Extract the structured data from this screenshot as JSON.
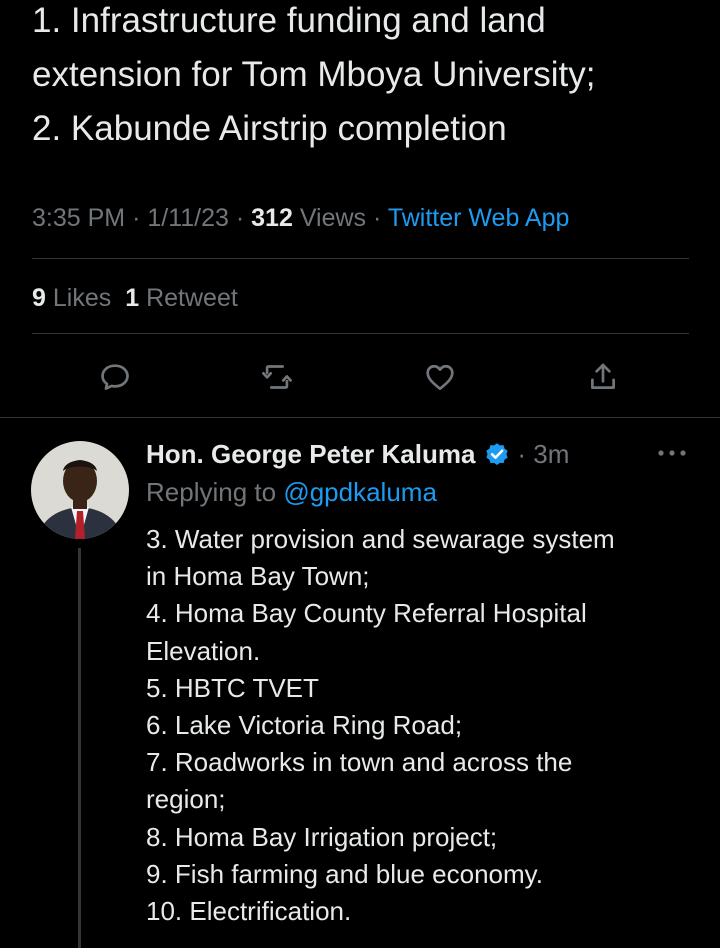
{
  "main_tweet": {
    "lines": [
      "1. Infrastructure funding and land",
      "extension for Tom Mboya University;",
      "2. Kabunde Airstrip completion"
    ],
    "time": "3:35 PM",
    "date": "1/11/23",
    "views_count": "312",
    "views_label": "Views",
    "source": "Twitter Web App",
    "separator": "·"
  },
  "stats": {
    "likes_count": "9",
    "likes_label": "Likes",
    "retweets_count": "1",
    "retweets_label": "Retweet"
  },
  "actions": {
    "icons": [
      "reply-icon",
      "retweet-icon",
      "like-icon",
      "share-icon"
    ]
  },
  "reply": {
    "author_name": "Hon. George Peter Kaluma",
    "time": "· 3m",
    "replying_prefix": "Replying to",
    "replying_handle": "@gpdkaluma",
    "lines": [
      "3. Water provision and sewarage system",
      "in Homa Bay Town;",
      "4. Homa Bay County Referral Hospital",
      "Elevation.",
      "5. HBTC TVET",
      "6. Lake Victoria Ring Road;",
      "7. Roadworks in town and across the",
      "region;",
      "8. Homa Bay Irrigation project;",
      "9. Fish farming and blue economy.",
      "10. Electrification."
    ]
  },
  "colors": {
    "background": "#000000",
    "text": "#e7e9ea",
    "muted": "#71767b",
    "accent": "#1d9bf0",
    "divider": "#2f3336"
  }
}
